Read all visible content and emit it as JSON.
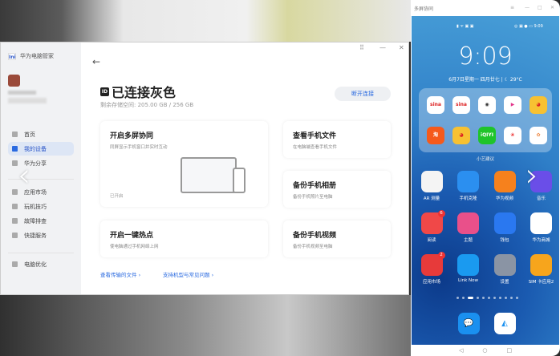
{
  "pc": {
    "app_name": "华为电脑管家",
    "window_controls": [
      "grid-icon",
      "minimize-icon",
      "close-icon"
    ],
    "sidebar": [
      {
        "label": "首页",
        "icon": "home-icon"
      },
      {
        "label": "我的设备",
        "icon": "devices-icon",
        "selected": true
      },
      {
        "label": "华为分享",
        "icon": "share-icon"
      },
      {
        "label": "应用市场",
        "icon": "store-icon"
      },
      {
        "label": "玩机技巧",
        "icon": "tips-icon"
      },
      {
        "label": "故障排查",
        "icon": "wrench-icon"
      },
      {
        "label": "快捷服务",
        "icon": "service-icon"
      },
      {
        "label": "电脑优化",
        "icon": "optimize-icon"
      }
    ],
    "device_title": "已连接灰色",
    "storage": "剩余存储空间:  205.00 GB / 256 GB",
    "disconnect": "断开连接",
    "cards": {
      "multiscreen": {
        "title": "开启多屏协同",
        "desc": "同屏显示手机窗口并实时互动",
        "status": "已开启"
      },
      "hotspot": {
        "title": "开启一键热点",
        "desc": "使电脑通过手机网络上网"
      },
      "files": {
        "title": "查看手机文件",
        "desc": "在电脑端查看手机文件"
      },
      "photos": {
        "title": "备份手机相册",
        "desc": "备份手机照片至电脑"
      },
      "videos": {
        "title": "备份手机视频",
        "desc": "备份手机视频至电脑"
      }
    },
    "links": [
      "查看传输的文件 ›",
      "支持机型与常见问题 ›"
    ]
  },
  "phone": {
    "window_title": "多屏协同",
    "status_time": "9:09",
    "clock": "9:09",
    "date": "6月7日星期一  四月廿七  |  ☾ 29°C",
    "suggest_label": "小艺建议",
    "folder": [
      {
        "t": "sina",
        "c": "#fff",
        "f": "#d22"
      },
      {
        "t": "sina",
        "c": "#fff",
        "f": "#d22"
      },
      {
        "t": "◉",
        "c": "#fff",
        "f": "#333"
      },
      {
        "t": "▶",
        "c": "#fff",
        "f": "#e2348a"
      },
      {
        "t": "◕",
        "c": "#f7c132",
        "f": "#d22"
      },
      {
        "t": "淘",
        "c": "#f55a1c",
        "f": "#fff"
      },
      {
        "t": "◕",
        "c": "#f7c132",
        "f": "#d22"
      },
      {
        "t": "iQIYI",
        "c": "#1fc42a",
        "f": "#fff"
      },
      {
        "t": "❀",
        "c": "#fff",
        "f": "#e44"
      },
      {
        "t": "✿",
        "c": "#fff",
        "f": "#e84"
      }
    ],
    "apps": [
      {
        "label": "AR 测量",
        "color": "#f4f4f4"
      },
      {
        "label": "手机克隆",
        "color": "#2b8ff0"
      },
      {
        "label": "华为视频",
        "color": "#f6811d"
      },
      {
        "label": "音乐",
        "color": "#6a4ee8"
      },
      {
        "label": "阅读",
        "color": "#f04848",
        "badge": "6"
      },
      {
        "label": "主题",
        "color": "#e9508a"
      },
      {
        "label": "钱包",
        "color": "#2a78f0"
      },
      {
        "label": "华为商城",
        "color": "#fff"
      },
      {
        "label": "应用市场",
        "color": "#e73a3a",
        "badge": "2"
      },
      {
        "label": "Link Now",
        "color": "#1a9af0"
      },
      {
        "label": "设置",
        "color": "#8a94a4"
      },
      {
        "label": "SIM 卡应用2",
        "color": "#f7a51c"
      }
    ],
    "dock": [
      {
        "name": "messages",
        "color": "#1a90f0"
      },
      {
        "name": "browser",
        "color": "#fff"
      }
    ],
    "page_count": 11,
    "active_page": 2,
    "nav": [
      "◁",
      "○",
      "□"
    ]
  },
  "overlay": {
    "prev": "‹",
    "next": "›"
  }
}
